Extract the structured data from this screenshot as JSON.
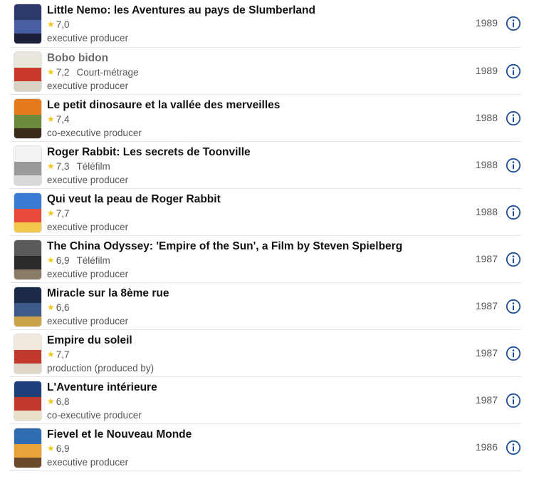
{
  "filmography": [
    {
      "title": "Little Nemo: les Aventures au pays de Slumberland",
      "rating": "7,0",
      "type": "",
      "role": "executive producer",
      "year": "1989",
      "muted": false,
      "poster": [
        "#2b3a6b",
        "#4a5fa3",
        "#1a1f3a"
      ]
    },
    {
      "title": "Bobo bidon",
      "rating": "7,2",
      "type": "Court-métrage",
      "role": "executive producer",
      "year": "1989",
      "muted": true,
      "poster": [
        "#e9e6dc",
        "#c93a2c",
        "#d8d2c4"
      ]
    },
    {
      "title": "Le petit dinosaure et la vallée des merveilles",
      "rating": "7,4",
      "type": "",
      "role": "co-executive producer",
      "year": "1988",
      "muted": false,
      "poster": [
        "#e37a1e",
        "#6b8a3b",
        "#3b2a1a"
      ]
    },
    {
      "title": "Roger Rabbit: Les secrets de Toonville",
      "rating": "7,3",
      "type": "Téléfilm",
      "role": "executive producer",
      "year": "1988",
      "muted": false,
      "poster": [
        "#f2f2f2",
        "#9a9a9a",
        "#d9d9d9"
      ]
    },
    {
      "title": "Qui veut la peau de Roger Rabbit",
      "rating": "7,7",
      "type": "",
      "role": "executive producer",
      "year": "1988",
      "muted": false,
      "poster": [
        "#3a7bd5",
        "#e84b3c",
        "#f2c94c"
      ]
    },
    {
      "title": "The China Odyssey: 'Empire of the Sun', a Film by Steven Spielberg",
      "rating": "6,9",
      "type": "Téléfilm",
      "role": "executive producer",
      "year": "1987",
      "muted": false,
      "poster": [
        "#5a5a5a",
        "#2a2a2a",
        "#8a7a66"
      ]
    },
    {
      "title": "Miracle sur la 8ème rue",
      "rating": "6,6",
      "type": "",
      "role": "executive producer",
      "year": "1987",
      "muted": false,
      "poster": [
        "#1c2a4a",
        "#3d5a8a",
        "#c9a24a"
      ]
    },
    {
      "title": "Empire du soleil",
      "rating": "7,7",
      "type": "",
      "role": "production (produced by)",
      "year": "1987",
      "muted": false,
      "poster": [
        "#efe9df",
        "#c0392b",
        "#e0d6c6"
      ]
    },
    {
      "title": "L'Aventure intérieure",
      "rating": "6,8",
      "type": "",
      "role": "co-executive producer",
      "year": "1987",
      "muted": false,
      "poster": [
        "#1d3f7a",
        "#c0392b",
        "#e8e0c8"
      ]
    },
    {
      "title": "Fievel et le Nouveau Monde",
      "rating": "6,9",
      "type": "",
      "role": "executive producer",
      "year": "1986",
      "muted": false,
      "poster": [
        "#2e6db0",
        "#e8a33a",
        "#6b4a2a"
      ]
    }
  ],
  "colors": {
    "star": "#f5c518",
    "info_icon": "#1f4f96"
  },
  "icons": {
    "rating": "star-icon",
    "details": "info-circle-icon"
  }
}
